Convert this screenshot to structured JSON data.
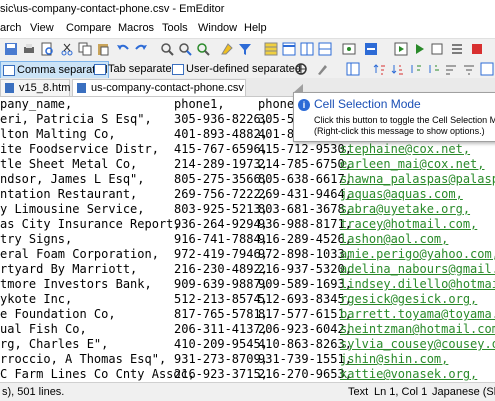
{
  "window": {
    "title": "sic\\us-company-contact-phone.csv - EmEditor"
  },
  "menu": [
    "arch",
    "View",
    "Compare",
    "Macros",
    "Tools",
    "Window",
    "Help"
  ],
  "csv_toolbar": {
    "comma": "Comma separated",
    "tab": "Tab separated",
    "user_defined": "User-defined separated"
  },
  "tabs": [
    "v15_8.htm",
    "us-company-contact-phone.csv"
  ],
  "tooltip": {
    "title": "Cell Selection Mode",
    "line1": "Click this button to toggle the Cell Selection M",
    "line2": "(Right-click this message to show options.)"
  },
  "rows": [
    [
      "pany_name,",
      "phone1,",
      "phone",
      ""
    ],
    [
      "eri, Patricia S Esq\",",
      "305-936-8226,",
      "305-5",
      ""
    ],
    [
      "lton Malting Co,",
      "401-893-4882,",
      "401-8",
      ""
    ],
    [
      "ite Foodservice Distr,",
      "415-767-6596,",
      "415-712-9530,",
      "stephaine@cox.net,"
    ],
    [
      "tle Sheet Metal Co,",
      "214-289-1973,",
      "214-785-6750,",
      "earleen_mai@cox.net,"
    ],
    [
      "ndsor, James L Esq\",",
      "805-275-3566,",
      "805-638-6617,",
      "shawna_palaspas@palaspas."
    ],
    [
      "ntation Restaurant,",
      "269-756-7222,",
      "269-431-9464,",
      "jaquas@aquas.com,"
    ],
    [
      "y Limousine Service,",
      "803-925-5213,",
      "803-681-3678,",
      "sabra@uyetake.org,"
    ],
    [
      "as City Insurance Report,",
      "936-264-9294,",
      "936-988-8171,",
      "tracey@hotmail.com,"
    ],
    [
      "try Signs,",
      "916-741-7884,",
      "916-289-4526,",
      "lashon@aol.com,"
    ],
    [
      "eral Foam Corporation,",
      "972-419-7946,",
      "972-898-1033,",
      "amie.perigo@yahoo.com,"
    ],
    [
      "rtyard By Marriott,",
      "216-230-4892,",
      "216-937-5320,",
      "adelina_nabours@gmail.com,"
    ],
    [
      "tmore Investors Bank,",
      "909-639-9887,",
      "909-589-1693,",
      "lindsey.dilello@hotmail.c"
    ],
    [
      "ykote Inc,",
      "512-213-8574,",
      "512-693-8345,",
      "rgesick@gesick.org,"
    ],
    [
      "e Foundation Co,",
      "817-765-5781,",
      "817-577-6151,",
      "barrett.toyama@toyama.org"
    ],
    [
      "ual Fish Co,",
      "206-311-4137,",
      "206-923-6042,",
      "sheintzman@hotmail.com,"
    ],
    [
      "rg, Charles E\",",
      "410-209-9545,",
      "410-863-8263,",
      "sylvia_cousey@cousey.org,"
    ],
    [
      "rroccio, A Thomas Esq\",",
      "931-273-8709,",
      "931-739-1551,",
      "jshin@shin.com,"
    ],
    [
      "C Farm Lines Co Cnty Assoc,",
      "216-923-3715,",
      "216-270-9653,",
      "kattie@vonasek.org,"
    ]
  ],
  "status": {
    "left": "s), 501 lines.",
    "text": "Text",
    "position": "Ln 1, Col 1",
    "encoding": "Japanese (Shift-J"
  }
}
